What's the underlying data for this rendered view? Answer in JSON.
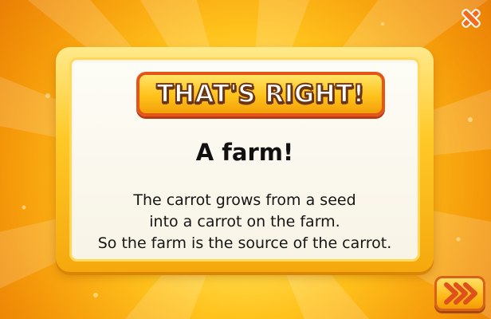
{
  "banner": {
    "text": "THAT'S RIGHT!"
  },
  "answer": {
    "headline": "A farm!"
  },
  "explanation": {
    "lines": [
      "The carrot grows from a seed",
      "into a carrot on the farm.",
      "So the farm is the source of the carrot."
    ]
  },
  "icons": {
    "close": "close-x-icon",
    "next": "double-chevron-right-icon"
  },
  "colors": {
    "background": "#ffc21c",
    "panel_frame": "#ffc928",
    "banner_border": "#e4551a",
    "close_icon": "#f26a1b"
  }
}
